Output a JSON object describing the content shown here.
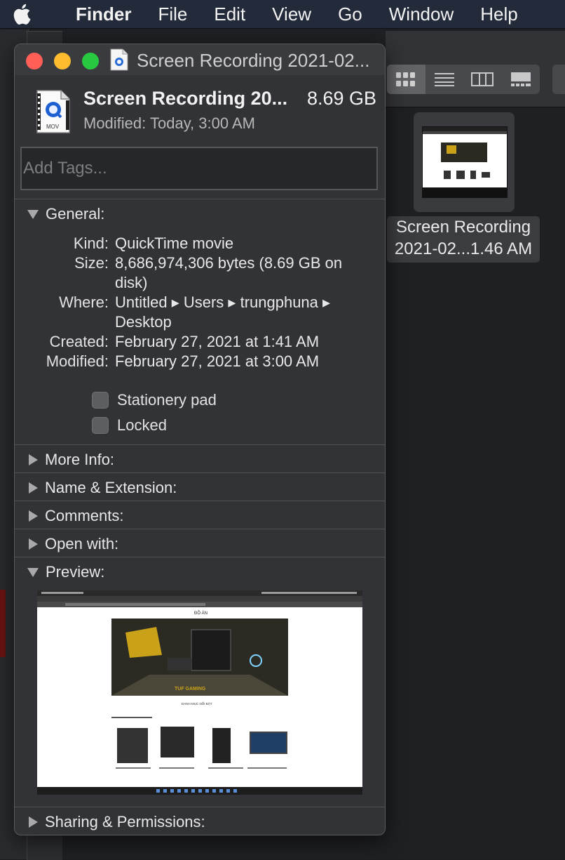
{
  "menubar": {
    "app": "Finder",
    "items": [
      "File",
      "Edit",
      "View",
      "Go",
      "Window",
      "Help"
    ]
  },
  "finder": {
    "file_label_line1": "Screen Recording",
    "file_label_line2": "2021-02...1.46 AM"
  },
  "info": {
    "window_title": "Screen Recording 2021-02...",
    "file_name": "Screen Recording 20...",
    "file_size": "8.69 GB",
    "modified_line": "Modified:  Today, 3:00 AM",
    "icon_caption": "MOV",
    "tags_placeholder": "Add Tags...",
    "general": {
      "label": "General:",
      "rows": [
        {
          "key": "Kind:",
          "value": "QuickTime movie"
        },
        {
          "key": "Size:",
          "value": "8,686,974,306 bytes (8.69 GB on disk)"
        },
        {
          "key": "Where:",
          "value": "Untitled ▸ Users ▸ trungphuna ▸ Desktop"
        },
        {
          "key": "Created:",
          "value": "February 27, 2021 at 1:41 AM"
        },
        {
          "key": "Modified:",
          "value": "February 27, 2021 at 3:00 AM"
        }
      ],
      "stationery": "Stationery pad",
      "locked": "Locked"
    },
    "sections": {
      "more_info": "More Info:",
      "name_ext": "Name & Extension:",
      "comments": "Comments:",
      "open_with": "Open with:",
      "preview": "Preview:",
      "sharing": "Sharing & Permissions:"
    },
    "preview_page": {
      "site_title": "ĐỒ ÁN",
      "banner_text": "TUF GAMING",
      "section_heading": "DANH MỤC NỔI BẬT"
    }
  },
  "colors": {
    "menubar": "#232a3a",
    "panel": "#323336",
    "close": "#ff5f57",
    "minimize": "#febc2e",
    "zoom": "#28c840"
  }
}
